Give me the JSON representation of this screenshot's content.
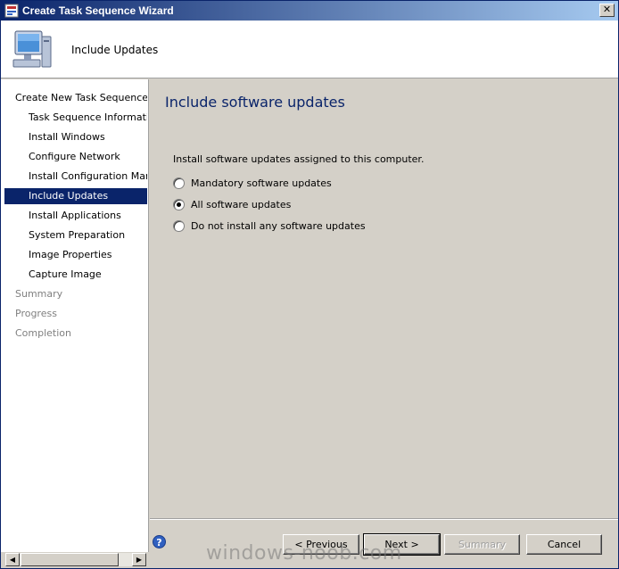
{
  "window": {
    "title": "Create Task Sequence Wizard",
    "close_glyph": "✕"
  },
  "header": {
    "title": "Include Updates"
  },
  "sidebar": {
    "items": [
      {
        "label": "Create New Task Sequence",
        "level": "top",
        "state": "normal"
      },
      {
        "label": "Task Sequence Information",
        "level": "sub",
        "state": "normal"
      },
      {
        "label": "Install Windows",
        "level": "sub",
        "state": "normal"
      },
      {
        "label": "Configure Network",
        "level": "sub",
        "state": "normal"
      },
      {
        "label": "Install Configuration Manag",
        "level": "sub",
        "state": "normal"
      },
      {
        "label": "Include Updates",
        "level": "sub",
        "state": "selected"
      },
      {
        "label": "Install Applications",
        "level": "sub",
        "state": "normal"
      },
      {
        "label": "System Preparation",
        "level": "sub",
        "state": "normal"
      },
      {
        "label": "Image Properties",
        "level": "sub",
        "state": "normal"
      },
      {
        "label": "Capture Image",
        "level": "sub",
        "state": "normal"
      },
      {
        "label": "Summary",
        "level": "top",
        "state": "disabled"
      },
      {
        "label": "Progress",
        "level": "top",
        "state": "disabled"
      },
      {
        "label": "Completion",
        "level": "top",
        "state": "disabled"
      }
    ],
    "scroll_left_glyph": "◀",
    "scroll_right_glyph": "▶"
  },
  "main": {
    "page_title": "Include software updates",
    "instruction": "Install software updates assigned to this computer.",
    "options": [
      {
        "label": "Mandatory software updates",
        "checked": false
      },
      {
        "label": "All software updates",
        "checked": true
      },
      {
        "label": "Do not install any software updates",
        "checked": false
      }
    ]
  },
  "footer": {
    "help_glyph": "?",
    "previous_label": "< Previous",
    "next_label": "Next >",
    "summary_label": "Summary",
    "cancel_label": "Cancel"
  },
  "watermark": "windows-noob.com",
  "colors": {
    "selection": "#0a246a",
    "title_text": "#0a246a",
    "face": "#d4d0c8"
  }
}
